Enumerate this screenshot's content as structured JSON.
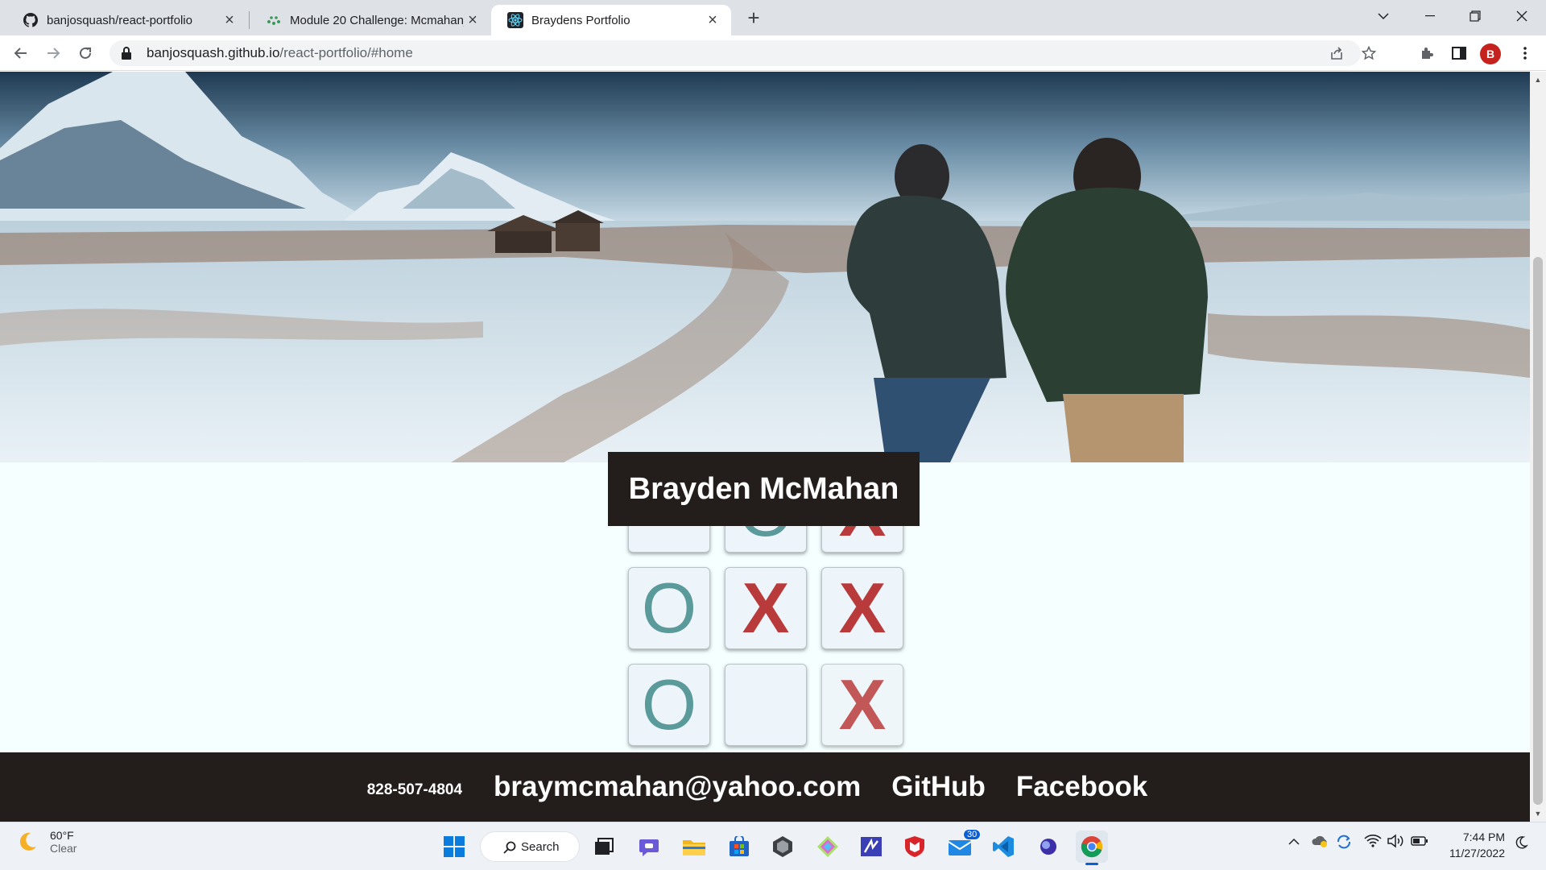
{
  "browser": {
    "tabs": [
      {
        "title": "banjosquash/react-portfolio",
        "icon": "github-icon",
        "active": false
      },
      {
        "title": "Module 20 Challenge: Mcmahan_",
        "icon": "canvas-icon",
        "active": false
      },
      {
        "title": "Braydens Portfolio",
        "icon": "react-icon",
        "active": true
      }
    ],
    "url_host": "banjosquash.github.io",
    "url_path": "/react-portfolio/#home",
    "profile_initial": "B",
    "profile_color": "#c5221f"
  },
  "page": {
    "hero_name": "Brayden McMahan",
    "board": [
      [
        "",
        "O",
        "X"
      ],
      [
        "O",
        "X",
        "X"
      ],
      [
        "O",
        "",
        "X"
      ]
    ],
    "footer": {
      "phone": "828-507-4804",
      "email": "braymcmahan@yahoo.com",
      "github": "GitHub",
      "facebook": "Facebook"
    },
    "colors": {
      "dark_bar": "#231d1c",
      "o_color": "#5a9a9a",
      "x_color": "#b83a3a",
      "background": "#f5ffff"
    }
  },
  "taskbar": {
    "weather_temp": "60°F",
    "weather_cond": "Clear",
    "search_label": "Search",
    "mail_badge": "30",
    "time": "7:44 PM",
    "date": "11/27/2022"
  }
}
